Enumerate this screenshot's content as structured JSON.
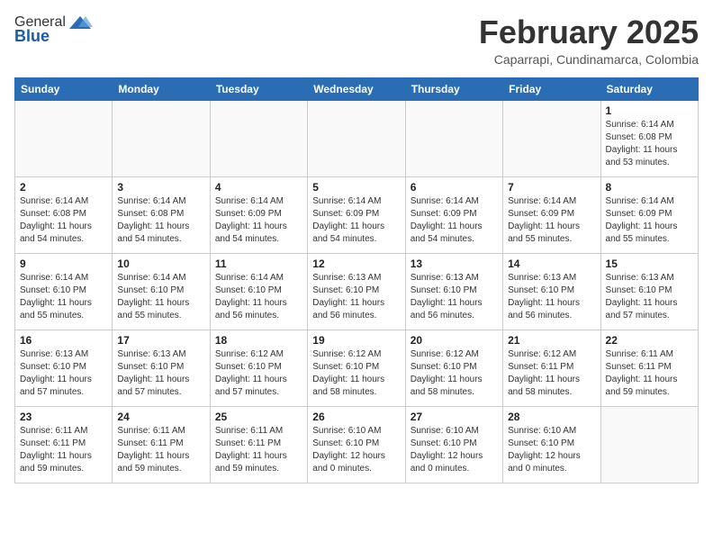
{
  "header": {
    "logo_general": "General",
    "logo_blue": "Blue",
    "title": "February 2025",
    "subtitle": "Caparrapi, Cundinamarca, Colombia"
  },
  "weekdays": [
    "Sunday",
    "Monday",
    "Tuesday",
    "Wednesday",
    "Thursday",
    "Friday",
    "Saturday"
  ],
  "weeks": [
    [
      {
        "day": "",
        "info": ""
      },
      {
        "day": "",
        "info": ""
      },
      {
        "day": "",
        "info": ""
      },
      {
        "day": "",
        "info": ""
      },
      {
        "day": "",
        "info": ""
      },
      {
        "day": "",
        "info": ""
      },
      {
        "day": "1",
        "info": "Sunrise: 6:14 AM\nSunset: 6:08 PM\nDaylight: 11 hours\nand 53 minutes."
      }
    ],
    [
      {
        "day": "2",
        "info": "Sunrise: 6:14 AM\nSunset: 6:08 PM\nDaylight: 11 hours\nand 54 minutes."
      },
      {
        "day": "3",
        "info": "Sunrise: 6:14 AM\nSunset: 6:08 PM\nDaylight: 11 hours\nand 54 minutes."
      },
      {
        "day": "4",
        "info": "Sunrise: 6:14 AM\nSunset: 6:09 PM\nDaylight: 11 hours\nand 54 minutes."
      },
      {
        "day": "5",
        "info": "Sunrise: 6:14 AM\nSunset: 6:09 PM\nDaylight: 11 hours\nand 54 minutes."
      },
      {
        "day": "6",
        "info": "Sunrise: 6:14 AM\nSunset: 6:09 PM\nDaylight: 11 hours\nand 54 minutes."
      },
      {
        "day": "7",
        "info": "Sunrise: 6:14 AM\nSunset: 6:09 PM\nDaylight: 11 hours\nand 55 minutes."
      },
      {
        "day": "8",
        "info": "Sunrise: 6:14 AM\nSunset: 6:09 PM\nDaylight: 11 hours\nand 55 minutes."
      }
    ],
    [
      {
        "day": "9",
        "info": "Sunrise: 6:14 AM\nSunset: 6:10 PM\nDaylight: 11 hours\nand 55 minutes."
      },
      {
        "day": "10",
        "info": "Sunrise: 6:14 AM\nSunset: 6:10 PM\nDaylight: 11 hours\nand 55 minutes."
      },
      {
        "day": "11",
        "info": "Sunrise: 6:14 AM\nSunset: 6:10 PM\nDaylight: 11 hours\nand 56 minutes."
      },
      {
        "day": "12",
        "info": "Sunrise: 6:13 AM\nSunset: 6:10 PM\nDaylight: 11 hours\nand 56 minutes."
      },
      {
        "day": "13",
        "info": "Sunrise: 6:13 AM\nSunset: 6:10 PM\nDaylight: 11 hours\nand 56 minutes."
      },
      {
        "day": "14",
        "info": "Sunrise: 6:13 AM\nSunset: 6:10 PM\nDaylight: 11 hours\nand 56 minutes."
      },
      {
        "day": "15",
        "info": "Sunrise: 6:13 AM\nSunset: 6:10 PM\nDaylight: 11 hours\nand 57 minutes."
      }
    ],
    [
      {
        "day": "16",
        "info": "Sunrise: 6:13 AM\nSunset: 6:10 PM\nDaylight: 11 hours\nand 57 minutes."
      },
      {
        "day": "17",
        "info": "Sunrise: 6:13 AM\nSunset: 6:10 PM\nDaylight: 11 hours\nand 57 minutes."
      },
      {
        "day": "18",
        "info": "Sunrise: 6:12 AM\nSunset: 6:10 PM\nDaylight: 11 hours\nand 57 minutes."
      },
      {
        "day": "19",
        "info": "Sunrise: 6:12 AM\nSunset: 6:10 PM\nDaylight: 11 hours\nand 58 minutes."
      },
      {
        "day": "20",
        "info": "Sunrise: 6:12 AM\nSunset: 6:10 PM\nDaylight: 11 hours\nand 58 minutes."
      },
      {
        "day": "21",
        "info": "Sunrise: 6:12 AM\nSunset: 6:11 PM\nDaylight: 11 hours\nand 58 minutes."
      },
      {
        "day": "22",
        "info": "Sunrise: 6:11 AM\nSunset: 6:11 PM\nDaylight: 11 hours\nand 59 minutes."
      }
    ],
    [
      {
        "day": "23",
        "info": "Sunrise: 6:11 AM\nSunset: 6:11 PM\nDaylight: 11 hours\nand 59 minutes."
      },
      {
        "day": "24",
        "info": "Sunrise: 6:11 AM\nSunset: 6:11 PM\nDaylight: 11 hours\nand 59 minutes."
      },
      {
        "day": "25",
        "info": "Sunrise: 6:11 AM\nSunset: 6:11 PM\nDaylight: 11 hours\nand 59 minutes."
      },
      {
        "day": "26",
        "info": "Sunrise: 6:10 AM\nSunset: 6:10 PM\nDaylight: 12 hours\nand 0 minutes."
      },
      {
        "day": "27",
        "info": "Sunrise: 6:10 AM\nSunset: 6:10 PM\nDaylight: 12 hours\nand 0 minutes."
      },
      {
        "day": "28",
        "info": "Sunrise: 6:10 AM\nSunset: 6:10 PM\nDaylight: 12 hours\nand 0 minutes."
      },
      {
        "day": "",
        "info": ""
      }
    ]
  ]
}
